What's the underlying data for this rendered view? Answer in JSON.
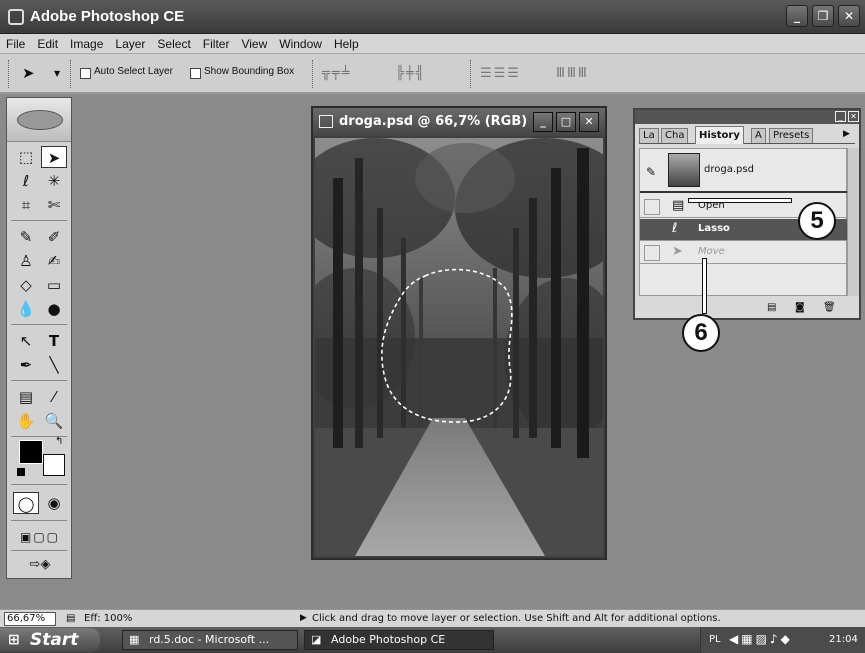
{
  "window": {
    "title": "Adobe Photoshop CE",
    "controls": {
      "minimize": "_",
      "restore": "❐",
      "close": "✕"
    }
  },
  "menu": [
    "File",
    "Edit",
    "Image",
    "Layer",
    "Select",
    "Filter",
    "View",
    "Window",
    "Help"
  ],
  "options_bar": {
    "auto_select_label": "Auto Select Layer",
    "show_bbox_label": "Show Bounding Box"
  },
  "document": {
    "title": "droga.psd @ 66,7% (RGB)"
  },
  "history_panel": {
    "tabs": [
      "La",
      "Cha",
      "History",
      "A",
      "Presets"
    ],
    "active_tab": "History",
    "snapshot": "droga.psd",
    "items": [
      {
        "label": "Open",
        "icon": "document-icon",
        "state": "normal"
      },
      {
        "label": "Lasso",
        "icon": "lasso-icon",
        "state": "selected"
      },
      {
        "label": "Move",
        "icon": "move-icon",
        "state": "dimmed"
      }
    ]
  },
  "callouts": {
    "c5": "5",
    "c6": "6"
  },
  "status_bar": {
    "zoom": "66,67%",
    "eff": "Eff: 100%",
    "message": "Click and drag to move layer or selection. Use Shift and Alt for additional options."
  },
  "taskbar": {
    "start": "Start",
    "tasks": [
      {
        "label": "rd.5.doc - Microsoft ...",
        "active": false
      },
      {
        "label": "Adobe Photoshop CE",
        "active": true
      }
    ],
    "lang": "PL",
    "time": "21:04"
  }
}
